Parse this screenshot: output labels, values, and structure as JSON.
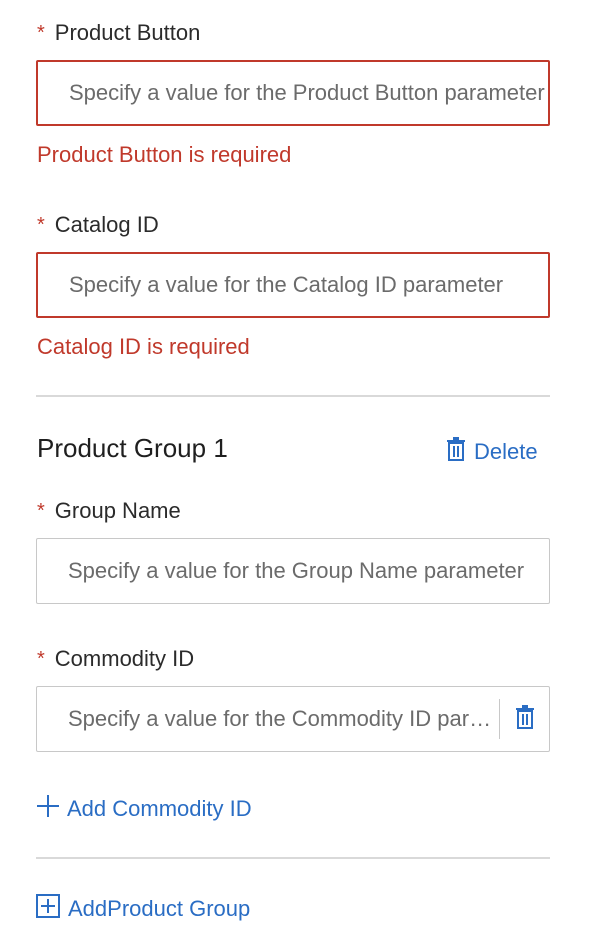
{
  "product_button": {
    "label": "Product Button",
    "required_mark": "*",
    "placeholder": "Specify a value for the Product Button parameter",
    "error": "Product Button is required"
  },
  "catalog_id": {
    "label": "Catalog ID",
    "required_mark": "*",
    "placeholder": "Specify a value for the Catalog ID parameter",
    "error": "Catalog ID is required"
  },
  "product_group": {
    "title": "Product Group 1",
    "delete_label": "Delete",
    "group_name": {
      "label": "Group Name",
      "required_mark": "*",
      "placeholder": "Specify a value for the Group Name parameter"
    },
    "commodity_id": {
      "label": "Commodity ID",
      "required_mark": "*",
      "placeholder": "Specify a value for the Commodity ID parameter"
    },
    "add_commodity_label": "Add Commodity ID"
  },
  "add_product_group_label": "AddProduct Group",
  "icons": {
    "delete": "trash-icon",
    "add": "plus-icon",
    "add_group": "plus-square-icon"
  },
  "colors": {
    "error": "#c0392b",
    "link": "#2a6dc4"
  }
}
